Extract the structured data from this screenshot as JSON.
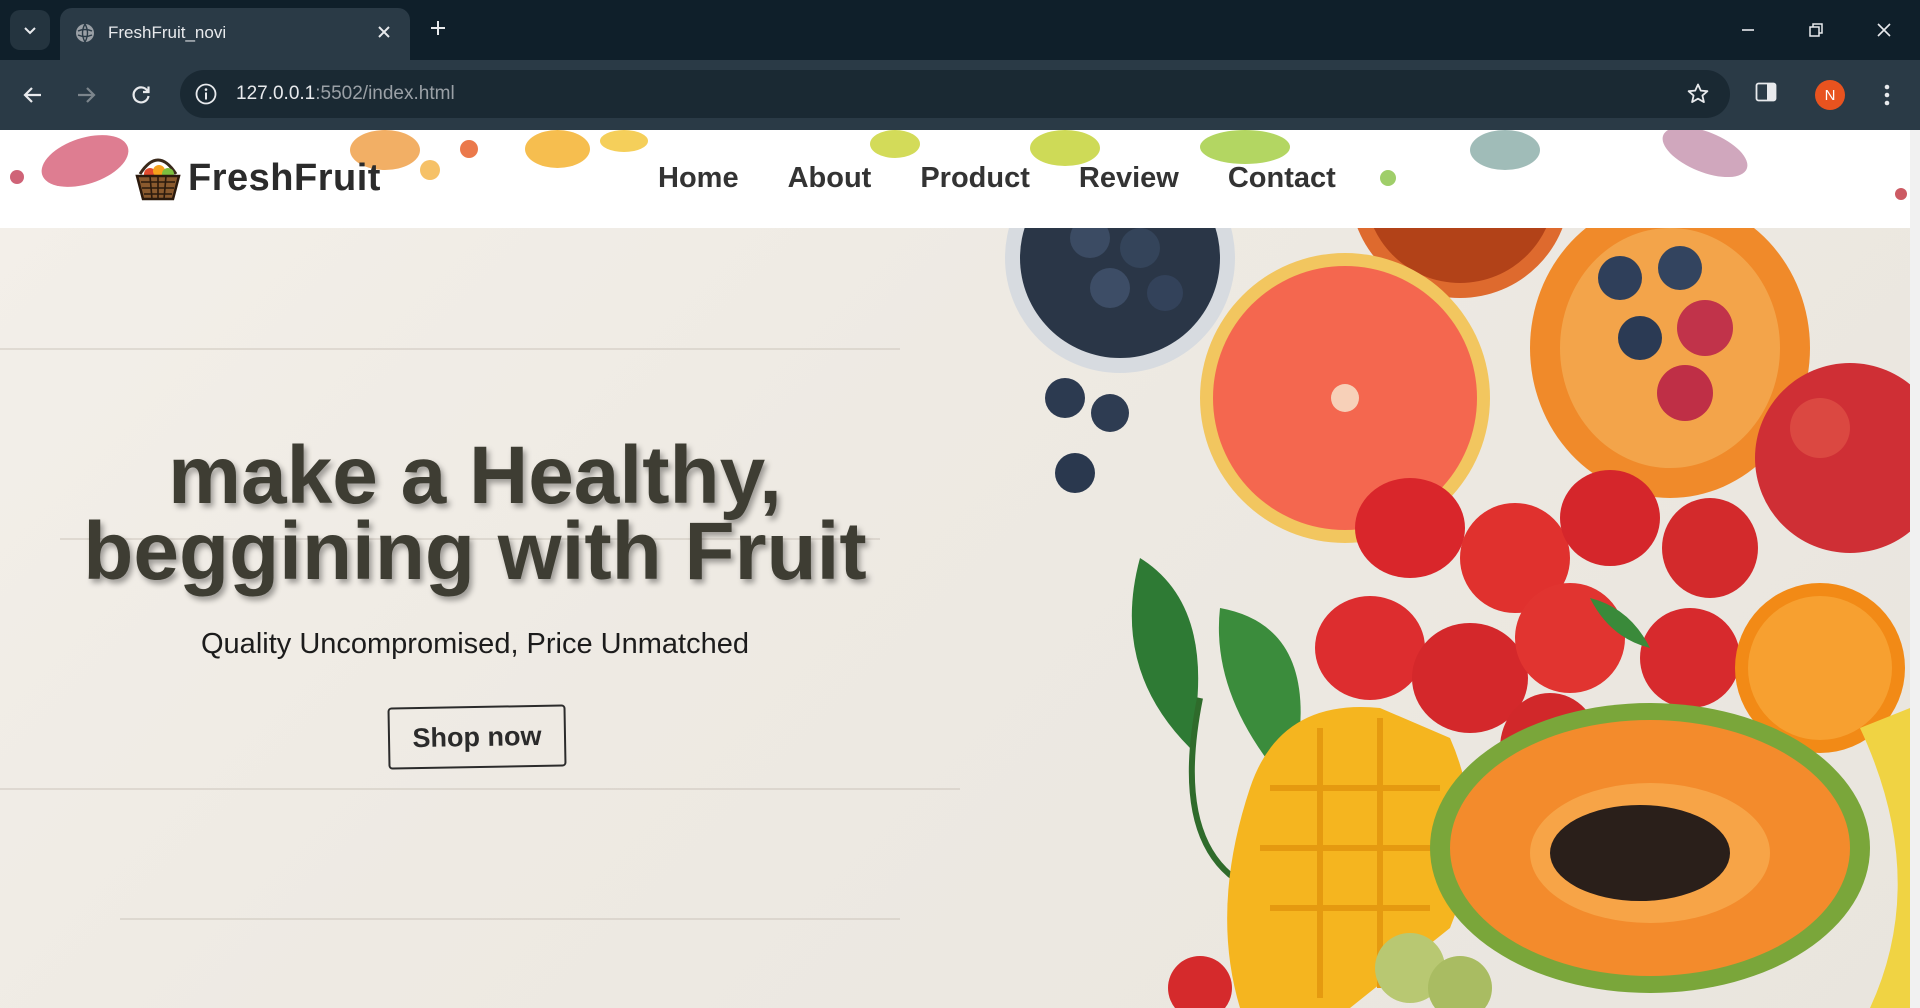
{
  "browser": {
    "tab_title": "FreshFruit_novi",
    "url_host": "127.0.0.1",
    "url_rest": ":5502/index.html",
    "profile_initial": "N"
  },
  "site": {
    "logo_text": "FreshFruit",
    "nav": [
      "Home",
      "About",
      "Product",
      "Review",
      "Contact"
    ]
  },
  "hero": {
    "headline_line1": "make a Healthy,",
    "headline_line2": "beggining with Fruit",
    "subtitle": "Quality Uncompromised, Price Unmatched",
    "cta_label": "Shop now"
  },
  "colors": {
    "chrome_dark": "#0f1f2a",
    "chrome_toolbar": "#2a3a46",
    "avatar": "#e8531f",
    "headline": "#3e3d33"
  }
}
